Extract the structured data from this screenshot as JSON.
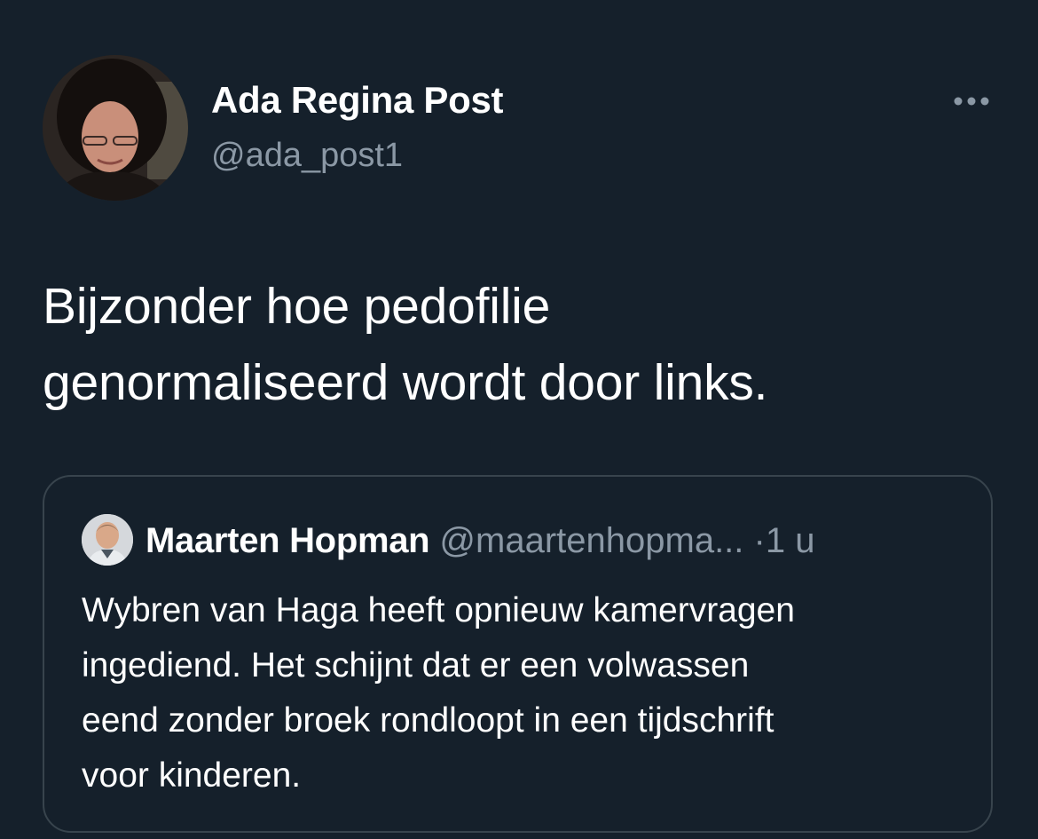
{
  "tweet": {
    "author": {
      "name": "Ada Regina Post",
      "handle": "@ada_post1",
      "avatar_icon": "user-avatar"
    },
    "more_icon": "more-options-icon",
    "text_lines": [
      "Bijzonder hoe pedofilie",
      "genormaliseerd wordt door links."
    ]
  },
  "quoted_tweet": {
    "author": {
      "name": "Maarten Hopman",
      "handle": "@maartenhopma...",
      "avatar_icon": "user-avatar"
    },
    "separator": "·",
    "time": "1 u",
    "text_lines": [
      "Wybren van Haga heeft opnieuw kamervragen",
      "ingediend. Het schijnt dat er een volwassen",
      "eend zonder broek rondloopt in een tijdschrift",
      "voor kinderen."
    ]
  },
  "colors": {
    "background": "#15202b",
    "primary_text": "#ffffff",
    "secondary_text": "#8b98a5",
    "border": "#38444d"
  }
}
